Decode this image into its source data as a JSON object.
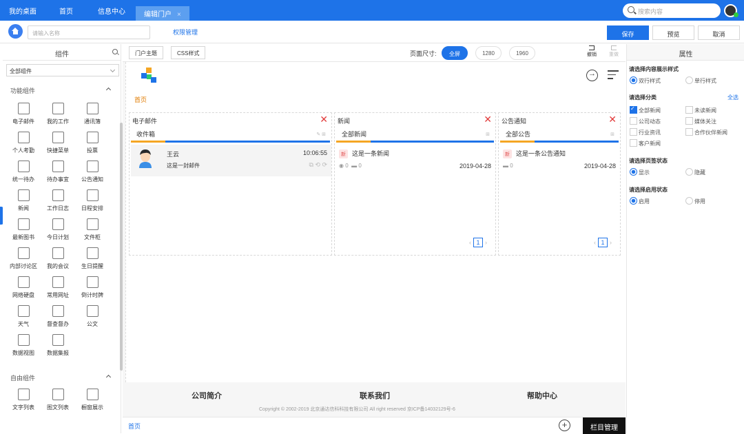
{
  "topbar": {
    "tabs": [
      "我的桌面",
      "首页",
      "信息中心"
    ],
    "active_tab": "编辑门户",
    "active_tab_close": "×",
    "search_placeholder": "搜索内容"
  },
  "toolbar": {
    "name_placeholder": "请输入名称",
    "permission_label": "权限管理",
    "save_label": "保存",
    "preview_label": "预览",
    "cancel_label": "取消"
  },
  "left_panel": {
    "title": "组件",
    "select_value": "全部组件",
    "section1_title": "功能组件",
    "section2_title": "自由组件",
    "components": [
      {
        "label": "电子邮件",
        "icon": "envelope-icon"
      },
      {
        "label": "我的工作",
        "icon": "edit-icon"
      },
      {
        "label": "通讯簿",
        "icon": "contacts-icon"
      },
      {
        "label": "个人考勤",
        "icon": "calendar-check-icon"
      },
      {
        "label": "快捷菜单",
        "icon": "grid-icon"
      },
      {
        "label": "投票",
        "icon": "vote-icon"
      },
      {
        "label": "统一待办",
        "icon": "clock-doc-icon"
      },
      {
        "label": "待办事宜",
        "icon": "list-doc-icon"
      },
      {
        "label": "公告通知",
        "icon": "speaker-icon"
      },
      {
        "label": "新闻",
        "icon": "news-icon"
      },
      {
        "label": "工作日志",
        "icon": "log-icon"
      },
      {
        "label": "日程安排",
        "icon": "schedule-icon"
      },
      {
        "label": "最新图书",
        "icon": "book-icon"
      },
      {
        "label": "今日计划",
        "icon": "plan-icon"
      },
      {
        "label": "文件柜",
        "icon": "folder-icon"
      },
      {
        "label": "内部讨论区",
        "icon": "chat-icon"
      },
      {
        "label": "我的会议",
        "icon": "meeting-icon"
      },
      {
        "label": "生日提醒",
        "icon": "cake-icon"
      },
      {
        "label": "网络硬盘",
        "icon": "disk-icon"
      },
      {
        "label": "常用网址",
        "icon": "star-icon"
      },
      {
        "label": "倒计时牌",
        "icon": "hourglass-icon"
      },
      {
        "label": "天气",
        "icon": "weather-icon"
      },
      {
        "label": "督查督办",
        "icon": "supervise-icon"
      },
      {
        "label": "公文",
        "icon": "document-icon"
      },
      {
        "label": "数据视图",
        "icon": "table-icon"
      },
      {
        "label": "数据集报",
        "icon": "report-icon"
      }
    ],
    "free_components": [
      {
        "label": "文字列表",
        "icon": "text-list-icon"
      },
      {
        "label": "图文列表",
        "icon": "image-list-icon"
      },
      {
        "label": "橱窗展示",
        "icon": "showcase-icon"
      }
    ]
  },
  "center": {
    "portal_theme": "门户主题",
    "css_style": "CSS样式",
    "page_size_label": "页面尺寸:",
    "sizes": [
      "全屏",
      "1280",
      "1960"
    ],
    "undo": "撤销",
    "redo": "重做",
    "breadcrumb": "首页",
    "cards": {
      "mail": {
        "title": "电子邮件",
        "tab": "收件箱",
        "sender": "王云",
        "time": "10:06:55",
        "subject": "这是一封邮件"
      },
      "news": {
        "title": "新闻",
        "tab": "全部新闻",
        "tag": "新",
        "item": "这是一条新闻",
        "views": "0",
        "comments": "0",
        "date": "2019-04-28",
        "page": "1"
      },
      "notice": {
        "title": "公告通知",
        "tab": "全部公告",
        "tag": "新",
        "item": "这是一条公告通知",
        "comments": "0",
        "date": "2019-04-28",
        "page": "1"
      }
    },
    "footer": {
      "links": [
        "公司简介",
        "联系我们",
        "帮助中心"
      ],
      "copyright": "Copyright © 2002-2019 北京通达信科科技有限公司 All right reserved 京ICP备14032129号-6"
    },
    "bottom_tab": "首页",
    "column_manage": "栏目管理"
  },
  "right_panel": {
    "title": "属性",
    "q1": "请选择内容展示样式",
    "q1_options": [
      "双行样式",
      "单行样式"
    ],
    "q2": "请选择分类",
    "select_all": "全选",
    "categories": [
      {
        "label": "全部新闻",
        "checked": true
      },
      {
        "label": "未读新闻",
        "checked": false
      },
      {
        "label": "公司动态",
        "checked": false
      },
      {
        "label": "媒体关注",
        "checked": false
      },
      {
        "label": "行业资讯",
        "checked": false
      },
      {
        "label": "合作伙伴新闻",
        "checked": false
      },
      {
        "label": "客户新闻",
        "checked": false
      }
    ],
    "q3": "请选择页签状态",
    "q3_options": [
      "显示",
      "隐藏"
    ],
    "q4": "请选择启用状态",
    "q4_options": [
      "启用",
      "停用"
    ]
  },
  "colors": {
    "primary": "#1e73e8",
    "accent": "#f5a623",
    "close": "#e23b3b"
  }
}
